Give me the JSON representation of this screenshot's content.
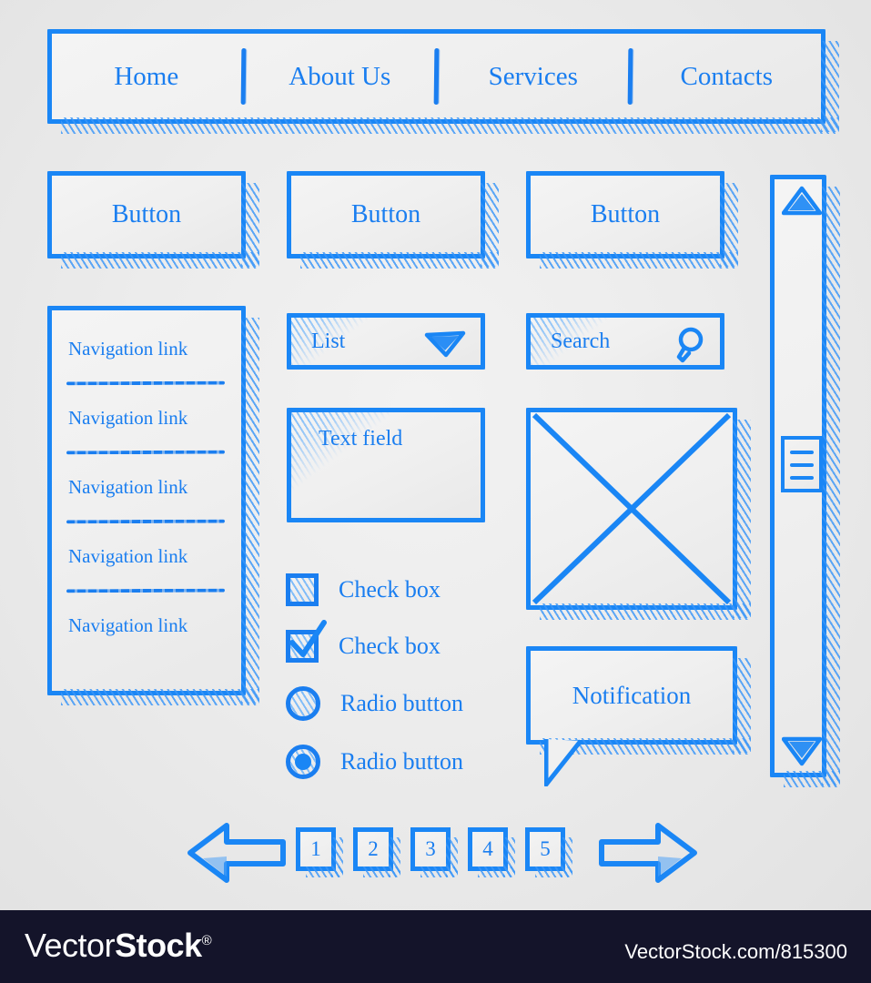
{
  "theme": {
    "accent": "#1a86f5",
    "text_blue": "#1a7ef0",
    "hatch": "#3a96f8",
    "background": "#ececec",
    "footer_bg": "#14142a"
  },
  "navbar": {
    "items": [
      {
        "label": "Home"
      },
      {
        "label": "About Us"
      },
      {
        "label": "Services"
      },
      {
        "label": "Contacts"
      }
    ]
  },
  "buttons": [
    {
      "label": "Button"
    },
    {
      "label": "Button"
    },
    {
      "label": "Button"
    }
  ],
  "nav_panel": {
    "items": [
      {
        "label": "Navigation link"
      },
      {
        "label": "Navigation link"
      },
      {
        "label": "Navigation link"
      },
      {
        "label": "Navigation link"
      },
      {
        "label": "Navigation link"
      }
    ]
  },
  "list_dropdown": {
    "value": "List",
    "icon": "chevron-down-icon"
  },
  "search": {
    "value": "Search",
    "icon": "magnifier-icon"
  },
  "text_field": {
    "value": "Text field"
  },
  "image_placeholder": {
    "icon": "image-x-placeholder-icon"
  },
  "notification": {
    "label": "Notification"
  },
  "checkboxes": [
    {
      "label": "Check box",
      "checked": false
    },
    {
      "label": "Check box",
      "checked": true
    }
  ],
  "radios": [
    {
      "label": "Radio button",
      "selected": false
    },
    {
      "label": "Radio button",
      "selected": true
    }
  ],
  "scrollbar": {
    "up_icon": "triangle-up-icon",
    "down_icon": "triangle-down-icon",
    "thumb_grip_icon": "grip-lines-icon"
  },
  "pagination": {
    "prev_icon": "arrow-left-icon",
    "next_icon": "arrow-right-icon",
    "pages": [
      "1",
      "2",
      "3",
      "4",
      "5"
    ]
  },
  "footer": {
    "logo_vector": "Vector",
    "logo_stock": "Stock",
    "logo_reg": "®",
    "url": "VectorStock.com/815300"
  }
}
